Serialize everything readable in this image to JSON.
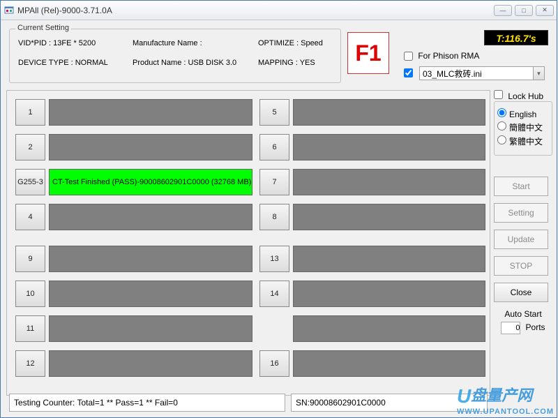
{
  "window": {
    "title": "MPAll (Rel)-9000-3.71.0A",
    "min": "—",
    "max": "□",
    "close": "✕"
  },
  "current_setting": {
    "legend": "Current Setting",
    "vid_pid_label": "VID*PID : 13FE * 5200",
    "device_type_label": "DEVICE TYPE : NORMAL",
    "manufacture_label": "Manufacture Name :",
    "product_label": "Product Name : USB DISK 3.0",
    "optimize_label": "OPTIMIZE : Speed",
    "mapping_label": "MAPPING : YES"
  },
  "f1": "F1",
  "timer": "T:116.7's",
  "for_phison_label": "For Phison RMA",
  "ini_checked": true,
  "ini_value": "03_MLC救砖.ini",
  "lock_hub_label": "Lock Hub",
  "lang": {
    "english": "English",
    "simp": "簡體中文",
    "trad": "繁體中文",
    "selected": "english"
  },
  "buttons": {
    "start": "Start",
    "setting": "Setting",
    "update": "Update",
    "stop": "STOP",
    "close": "Close"
  },
  "auto_start": {
    "label": "Auto Start",
    "value": "0",
    "ports": "Ports"
  },
  "slots_left": [
    "1",
    "2",
    "G255-3",
    "4",
    "9",
    "10",
    "11",
    "12"
  ],
  "slots_right": [
    "5",
    "6",
    "7",
    "8",
    "13",
    "14",
    "",
    "16"
  ],
  "pass_text": "CT-Test Finished (PASS)-90008602901C0000 (32768 MB)",
  "status": {
    "counter": "Testing Counter: Total=1 ** Pass=1 ** Fail=0",
    "sn": "SN:90008602901C0000"
  },
  "watermark": {
    "main": "盘量产网",
    "sub": "WWW.UPANTOOL.COM"
  }
}
